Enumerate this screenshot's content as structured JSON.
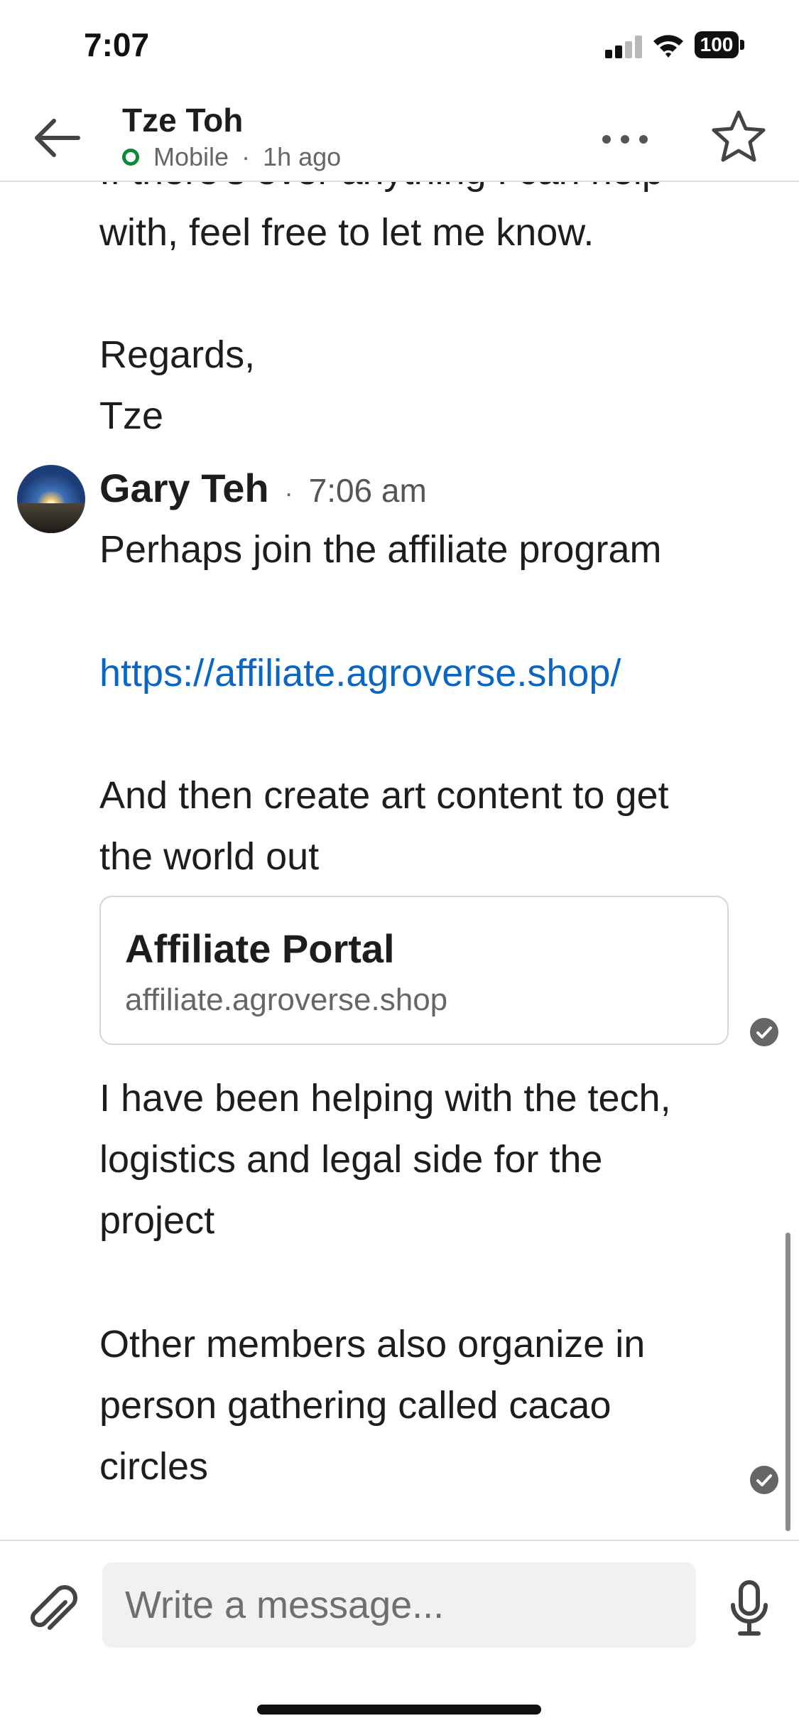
{
  "status_bar": {
    "time": "7:07",
    "battery": "100"
  },
  "header": {
    "contact_name": "Tze Toh",
    "presence": "Mobile",
    "separator": "·",
    "last_seen": "1h ago"
  },
  "thread": {
    "earlier_message": {
      "cut_off_line": "If there's ever anything I can help",
      "lines": "with, feel free to let me know.\n\nRegards,\nTze"
    },
    "message": {
      "sender": "Gary Teh",
      "separator": "·",
      "time": "7:06 am",
      "text_1": "Perhaps join the affiliate program",
      "link": "https://affiliate.agroverse.shop/",
      "text_2": "And then create art content to get\nthe world out",
      "preview": {
        "title": "Affiliate Portal",
        "domain": "affiliate.agroverse.shop"
      },
      "text_3": "I have been helping with the tech,\nlogistics and legal side for the\nproject",
      "text_4": "Other members also organize in\nperson gathering called cacao\ncircles"
    }
  },
  "composer": {
    "placeholder": "Write a message..."
  },
  "colors": {
    "link": "#0a66c2",
    "presence_online": "#0a8a3c",
    "input_bg": "#f1f1ef"
  }
}
